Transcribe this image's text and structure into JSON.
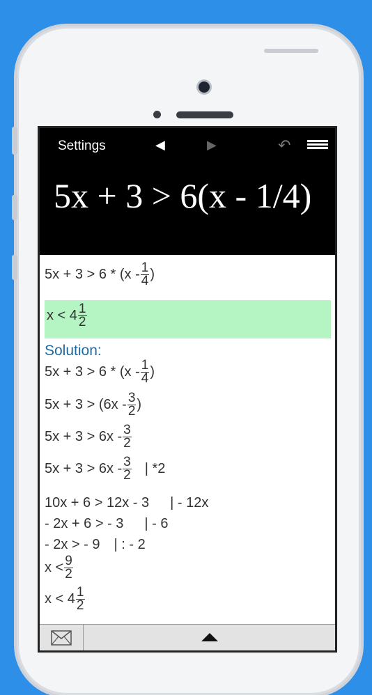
{
  "toolbar": {
    "settings_label": "Settings",
    "prev_icon": "◀",
    "next_icon": "▶",
    "undo_icon": "↶"
  },
  "display": {
    "expression": "5x + 3 > 6(x - 1/4)"
  },
  "input_line": {
    "left": "5x + 3 > 6 * (x - ",
    "num": "1",
    "den": "4",
    "right": ")"
  },
  "result": {
    "text": "x < 4",
    "num": "1",
    "den": "2"
  },
  "solution_label": "Solution:",
  "steps": {
    "s1": {
      "left": "5x + 3 > 6 * (x - ",
      "num": "1",
      "den": "4",
      "right": ")"
    },
    "s2": {
      "left": "5x + 3 > (6x - ",
      "num": "3",
      "den": "2",
      "right": ")"
    },
    "s3": {
      "left": "5x + 3 > 6x - ",
      "num": "3",
      "den": "2"
    },
    "s4": {
      "left": "5x + 3 > 6x - ",
      "num": "3",
      "den": "2",
      "op": "| *2"
    },
    "s5": {
      "text": "10x + 6 > 12x - 3",
      "op": "| - 12x"
    },
    "s6": {
      "text": "- 2x + 6 > - 3",
      "op": "| - 6"
    },
    "s7": {
      "text": "- 2x > - 9",
      "op": "| : - 2"
    },
    "s8": {
      "left": "x < ",
      "num": "9",
      "den": "2"
    },
    "s9": {
      "left": "x < 4",
      "num": "1",
      "den": "2"
    }
  },
  "bottom": {
    "mail_icon": "mail-icon",
    "up_icon": "triangle-up-icon"
  }
}
